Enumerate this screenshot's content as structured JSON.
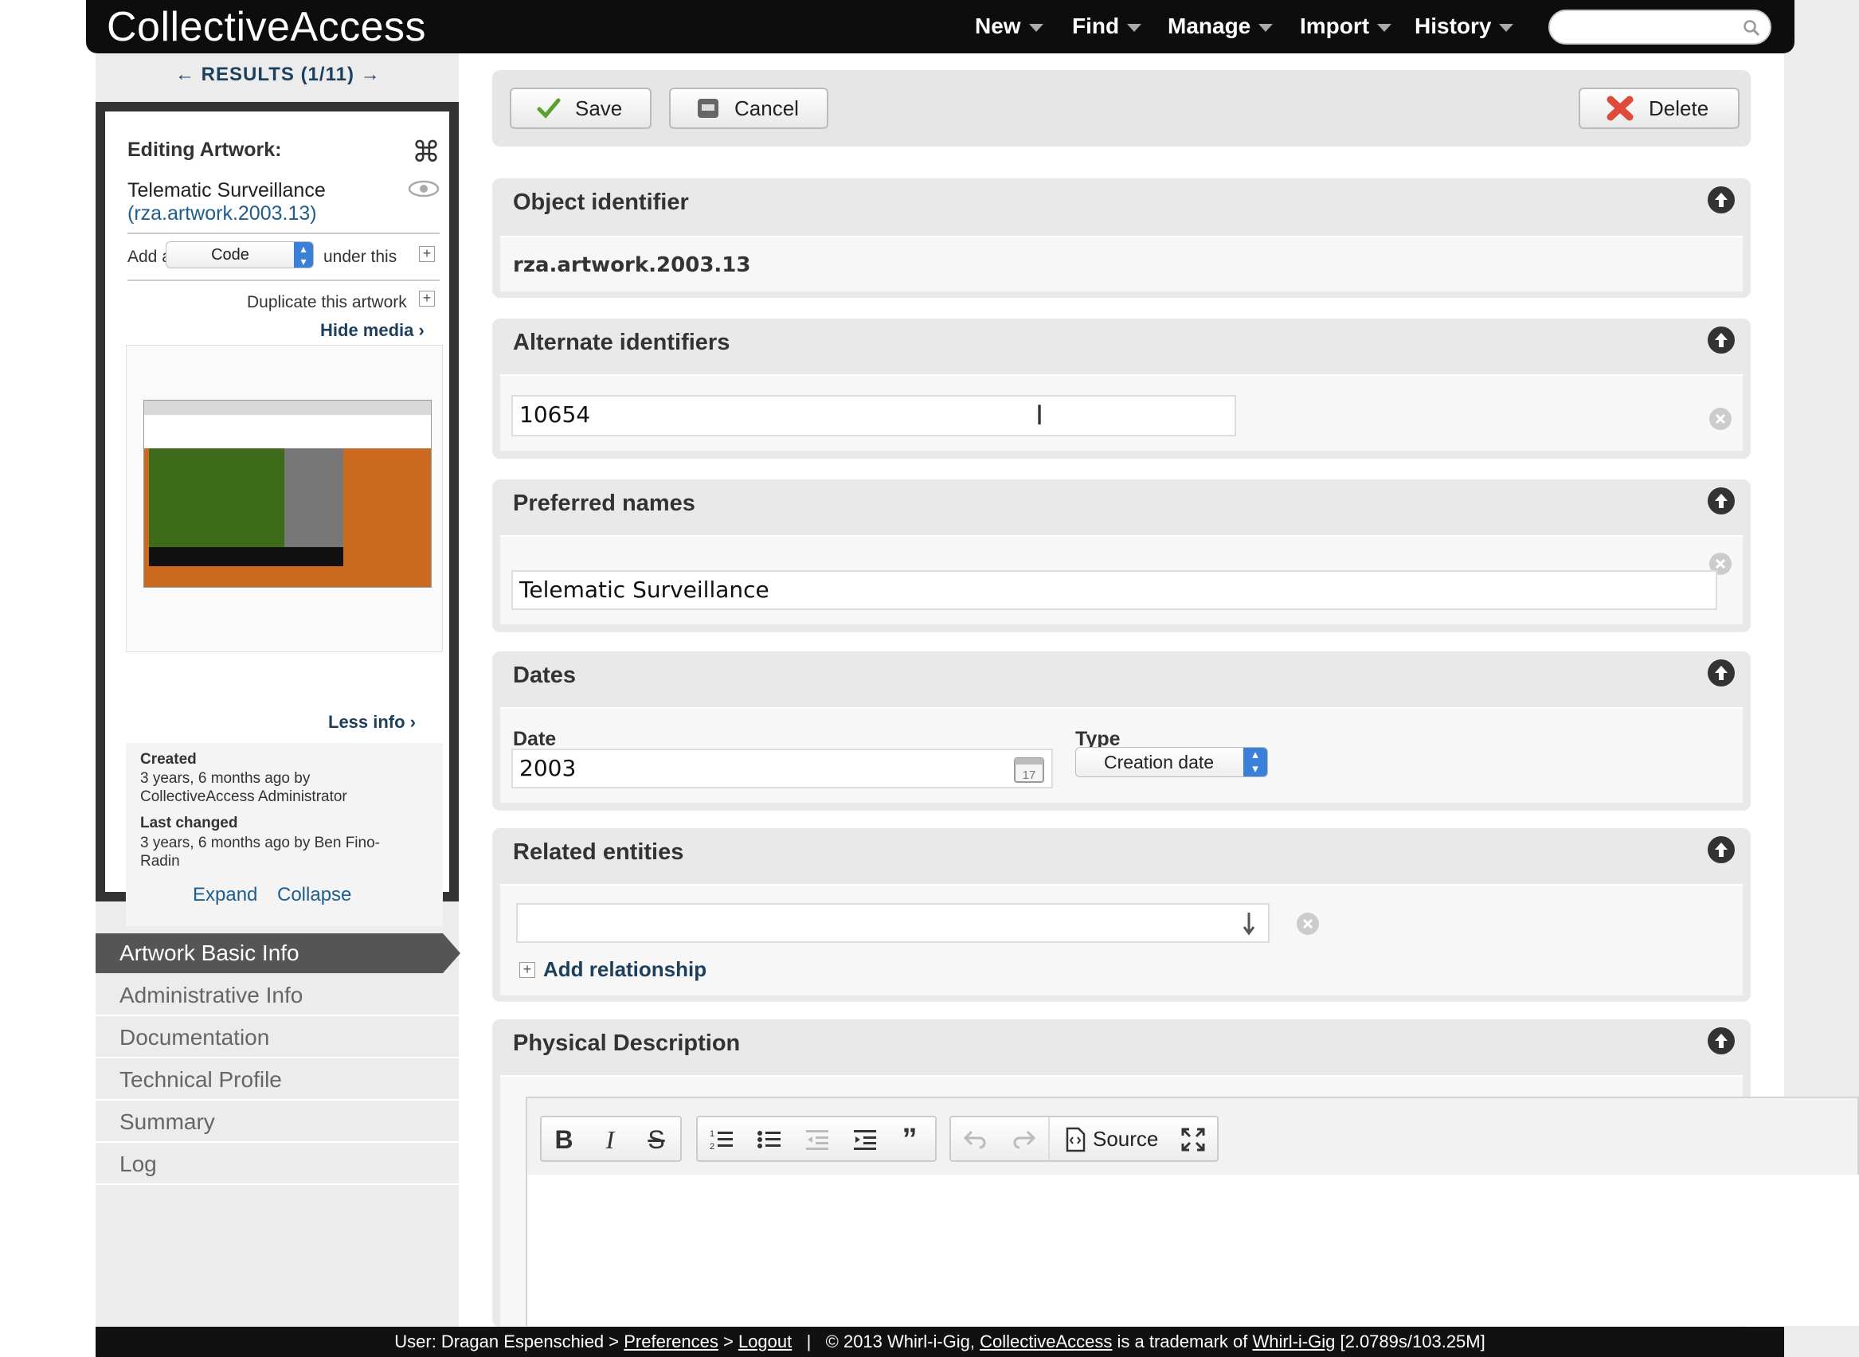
{
  "app": {
    "logo": "CollectiveAccess"
  },
  "nav": {
    "items": [
      "New",
      "Find",
      "Manage",
      "Import",
      "History"
    ]
  },
  "search": {
    "placeholder": ""
  },
  "results": {
    "label": "← RESULTS (1/11) →"
  },
  "inspector": {
    "heading": "Editing Artwork:",
    "name": "Telematic Surveillance",
    "identifier": "(rza.artwork.2003.13)",
    "add_a": "Add a",
    "add_type": "Code",
    "under_this": "under this",
    "duplicate": "Duplicate this artwork",
    "hide_media": "Hide media ›",
    "less_info": "Less info ›",
    "created_label": "Created",
    "created_value_1": "3 years, 6 months ago by",
    "created_value_2": "CollectiveAccess Administrator",
    "changed_label": "Last changed",
    "changed_value_1": "3 years, 6 months ago by Ben Fino-",
    "changed_value_2": "Radin",
    "expand": "Expand",
    "collapse": "Collapse"
  },
  "sidenav": {
    "active": "Artwork Basic Info",
    "items": [
      "Administrative Info",
      "Documentation",
      "Technical Profile",
      "Summary",
      "Log"
    ]
  },
  "toolbar": {
    "save": "Save",
    "cancel": "Cancel",
    "delete": "Delete"
  },
  "sections": {
    "object_identifier": {
      "title": "Object identifier",
      "value": "rza.artwork.2003.13"
    },
    "alternate_identifiers": {
      "title": "Alternate identifiers",
      "value": "10654"
    },
    "preferred_names": {
      "title": "Preferred names",
      "value": "Telematic Surveillance"
    },
    "dates": {
      "title": "Dates",
      "date_label": "Date",
      "date_value": "2003",
      "type_label": "Type",
      "type_value": "Creation date"
    },
    "related_entities": {
      "title": "Related entities",
      "value": "",
      "add_relationship": "Add relationship"
    },
    "physical_description": {
      "title": "Physical Description",
      "source_label": "Source"
    }
  },
  "footer": {
    "user": "User: Dragan Espenschied > ",
    "preferences": "Preferences",
    "sep1": " > ",
    "logout": "Logout",
    "sep2": "   |   © 2013 Whirl-i-Gig, ",
    "ca_link": "CollectiveAccess",
    "trademark": " is a trademark of ",
    "wig_link": "Whirl-i-Gig",
    "stats": " [2.0789s/103.25M]"
  },
  "colors": {
    "accent": "#1d3f5e",
    "header": "#0d0d0d",
    "nav_active": "#555555",
    "delete_red": "#e04a3a",
    "save_green": "#5aa02c"
  }
}
